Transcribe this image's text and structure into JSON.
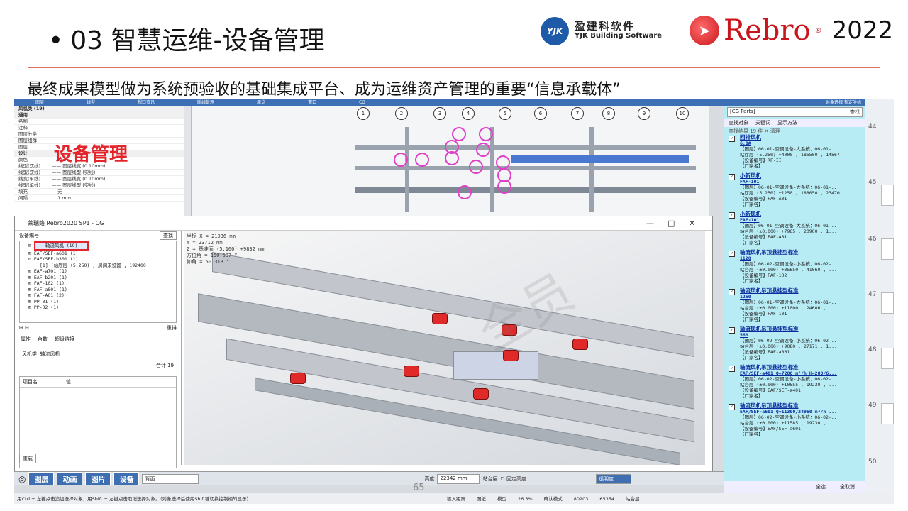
{
  "slide": {
    "title": "03 智慧运维-设备管理",
    "subtitle": "最终成果模型做为系统预验收的基础集成平台、成为运维资产管理的重要“信息承载体”",
    "page_number": "65"
  },
  "logos": {
    "yjk_badge": "YJK",
    "yjk_cn": "盈建科软件",
    "yjk_en": "YJK Building Software",
    "rebro_word": "Rebro",
    "rebro_year": "2022"
  },
  "colors": {
    "accent_red": "#e3242b",
    "toolbar_blue": "#3d6fb5",
    "panel_cyan": "#b8ecf4",
    "highlight_pink": "#e040c8"
  },
  "app": {
    "overlay_label": "设备管理",
    "property_panel": {
      "header": "风机类 (19)",
      "rows": [
        "通用",
        "名称",
        "注释",
        "图层分类",
        "图层组群",
        "图层",
        "设计",
        "颜色",
        "线型(双线)",
        "线型(双线)",
        "线宽(单线)",
        "线型(单线)",
        "填充",
        "间隔"
      ],
      "values": [
        "253",
        "—— 图层线宽 (0.10mm)",
        "—— 图层线型 (实线)",
        "无",
        "1 mm"
      ]
    },
    "window_title": "莱瑞络 Rebro2020 SP1 - CG",
    "tree": {
      "field_label": "设备编号",
      "search_button": "查找",
      "selected_node": "轴流风机 (19)",
      "nodes": [
        "EAF/SEF-a601 (1)",
        "EAF/SEF-h301 (1)",
        "[1] (站厅层 (5.250) , 房间未设置 , 192400",
        "EAF-a701 (1)",
        "EAF-b201 (1)",
        "FAF-102 (1)",
        "FAF-a801 (1)",
        "FAF-A01 (2)",
        "PP-01 (1)",
        "PP-02 (1)"
      ],
      "sort_button": "重排",
      "tabs": [
        "属性",
        "台数",
        "超级链接"
      ],
      "prop_key": "风机类",
      "prop_val": "轴流风机",
      "total": "合计 19",
      "col_item": "项目名",
      "col_value": "值",
      "reload_button": "重载"
    },
    "view_info": [
      "坐标 X = 21936 mm",
      "Y = 23712 mm",
      "Z = 基准面 (5.100) +9832 mm",
      "方位角 = 150.687 °",
      "仰角 = 50.313 °"
    ],
    "watermark": "全员",
    "bottom_toolbar": {
      "buttons": [
        "图层",
        "动画",
        "图片",
        "设备"
      ],
      "view_value": "背面",
      "height_label": "高度",
      "height_value": "22342 mm",
      "floor_label": "站台层",
      "fixed_height": "固定高度",
      "display_mode": "透明度"
    },
    "status_text": "用Ctrl + 左键点击追加选择对象，用Shift + 左键点击取消选择对象。（对象选择后使用Shift键切换控制柄的显示）",
    "status_right": [
      "键入距离",
      "图纸",
      "模型",
      "26.3%",
      "确认模式",
      "80203",
      "65354",
      "站台层"
    ],
    "top_tabs": [
      "图层",
      "线型",
      "视口资讯",
      "断线处理",
      "原点",
      "窗口",
      "CG"
    ],
    "right_panel": {
      "header": "对象选择  指定坐标",
      "search_value": "[CG Parts]",
      "search_button": "查找",
      "tools": [
        "查找对象",
        "关键词",
        "显示方法"
      ],
      "result_count": "查找结果  19 件",
      "clear": "清理",
      "items": [
        {
          "name": "回排风机",
          "value": "6.0#",
          "l1": "【图层】06-01-空调设备-大系统：06-01-..",
          "l2": "站厅层 (5.250) +4000 , 185500 , 14567",
          "l3": "【设备编号】RF-II",
          "l4": "【厂家名】"
        },
        {
          "name": "小新风机",
          "value": "FAF-101",
          "l1": "【图层】06-01-空调设备-大系统：06-01-..",
          "l2": "站厅层 (5.250) +1250 , 188050 , 23470",
          "l3": "【设备编号】FAF-A01",
          "l4": "【厂家名】"
        },
        {
          "name": "小新风机",
          "value": "FAF-101",
          "l1": "【图层】06-01-空调设备-大系统：06-01-..",
          "l2": "站台层 (±0.000) +7965 , 20900 , 1...",
          "l3": "【设备编号】FAF-A01",
          "l4": "【厂家名】"
        },
        {
          "name": "轴流风机吊顶悬挂型标准",
          "value": "1120",
          "l1": "【图层】06-02-空调设备-小系统：06-02-..",
          "l2": "站台层 (±0.000) +35650 , 41060 , ...",
          "l3": "【设备编号】FAF-102",
          "l4": "【厂家名】"
        },
        {
          "name": "轴流风机吊顶悬挂型标准",
          "value": "1250",
          "l1": "【图层】06-01-空调设备-大系统：06-01-..",
          "l2": "站台层 (±0.000) +11000 , 24606 , ...",
          "l3": "【设备编号】FAF-101",
          "l4": "【厂家名】"
        },
        {
          "name": "轴流风机吊顶悬挂型标准",
          "value": "560",
          "l1": "【图层】06-02-空调设备-小系统：06-02-..",
          "l2": "站台层 (±0.000) +9080 , 27171 , 1...",
          "l3": "【设备编号】FAF-a801",
          "l4": "【厂家名】"
        },
        {
          "name": "轴流风机吊顶悬挂型标准",
          "value": "EAF/SEF-a401 Q=7200 m³/h H=280/6...",
          "l1": "【图层】06-02-空调设备-小系统：06-02-..",
          "l2": "站台层 (±0.000) +10555 , 19230 , ...",
          "l3": "【设备编号】EAF/SEF-a401",
          "l4": "【厂家名】"
        },
        {
          "name": "轴流风机吊顶悬挂型标准",
          "value": "EAF/SEF-a601 Q=11300/24960 m³/h ...",
          "l1": "【图层】06-02-空调设备-小系统：06-02-..",
          "l2": "站台层 (±0.000) +11585 , 19230 , ...",
          "l3": "【设备编号】EAF/SEF-a601",
          "l4": "【厂家名】"
        }
      ],
      "select_all": "全选",
      "deselect_all": "全取消"
    },
    "grid_bubbles": [
      "1",
      "2",
      "3",
      "4",
      "5",
      "6",
      "7",
      "8",
      "9",
      "10"
    ],
    "thumb_numbers": [
      "44",
      "45",
      "46",
      "47",
      "48",
      "49",
      "50"
    ]
  }
}
